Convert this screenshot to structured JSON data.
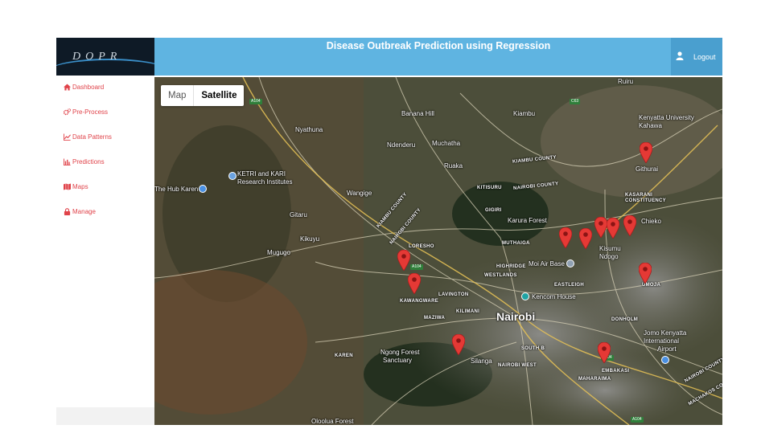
{
  "header": {
    "logo_text": "DOPR",
    "title": "Disease Outbreak Prediction using Regression",
    "logout_label": "Logout"
  },
  "sidebar": {
    "items": [
      {
        "label": "Dashboard",
        "icon": "home-icon"
      },
      {
        "label": "Pre-Process",
        "icon": "cogs-icon"
      },
      {
        "label": "Data Patterns",
        "icon": "line-chart-icon"
      },
      {
        "label": "Predictions",
        "icon": "bar-chart-icon"
      },
      {
        "label": "Maps",
        "icon": "map-icon"
      },
      {
        "label": "Manage",
        "icon": "lock-icon"
      }
    ]
  },
  "map": {
    "type_control": {
      "map_label": "Map",
      "satellite_label": "Satellite",
      "selected": "Satellite"
    },
    "labels": [
      "Ruiru",
      "Banana Hill",
      "Kiambu",
      "Kenyatta University",
      "Kahawa",
      "Nyathuna",
      "Ndenderu",
      "Muchatha",
      "Ruaka",
      "KIAMBU COUNTY",
      "NAIROBI COUNTY",
      "KIAMBU COUNTY",
      "NAIROBI COUNTY",
      "KITISURU",
      "KETRI and KARI",
      "Research Institutes",
      "The Hub Karen",
      "Wangige",
      "GIGIRI",
      "Karura Forest",
      "Githurai",
      "KASARANI",
      "CONSTITUENCY",
      "Chieko",
      "Gitaru",
      "Kikuyu",
      "Mugugo",
      "LORESHO",
      "MUTHAIGA",
      "Kisumu",
      "Ndogo",
      "HIGHRIDGE",
      "WESTLANDS",
      "Moi Air Base",
      "EASTLEIGH",
      "UMOJA",
      "LAVINGTON",
      "Kencom House",
      "KAWANGWARE",
      "KILIMANI",
      "MAZIWA",
      "Nairobi",
      "DONHOLM",
      "Jomo Kenyatta",
      "International",
      "Airport",
      "KAREN",
      "Ngong Forest",
      "Sanctuary",
      "SOUTH B",
      "Silanga",
      "NAIROBI WEST",
      "EMBAKASI",
      "MAHARAIMA",
      "NAIROBI COUNTY",
      "MACHAKOS COUNTY",
      "Oloolua Forest"
    ],
    "road_shields": [
      "A104",
      "A104",
      "C63",
      "A104",
      "A104"
    ],
    "marker_color": "#e53935"
  },
  "colors": {
    "header": "#5fb4e1",
    "accent": "#e0434a",
    "logo_bg": "#0e1a26"
  }
}
